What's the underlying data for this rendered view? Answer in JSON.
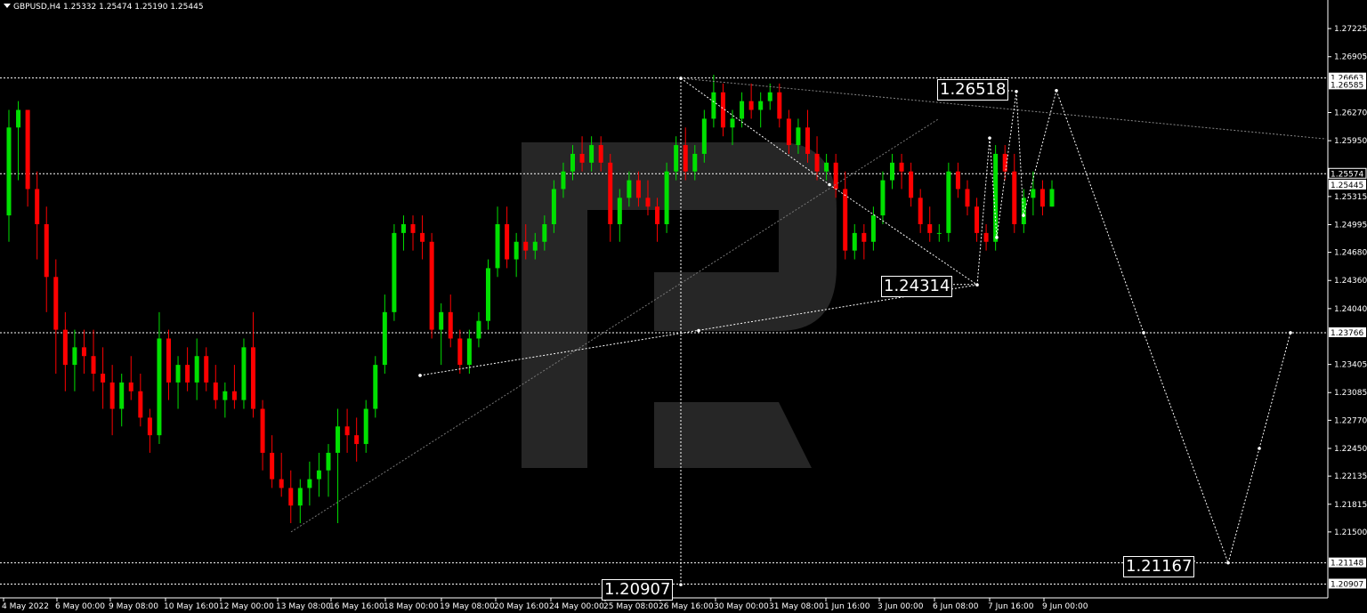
{
  "header": {
    "symbol": "GBPUSD,H4",
    "open": "1.25332",
    "high": "1.25474",
    "low": "1.25190",
    "close": "1.25445"
  },
  "colors": {
    "background": "#000000",
    "bull": "#00e000",
    "bear": "#ff0000",
    "text": "#ffffff",
    "logo": "#2a2a2a"
  },
  "chart_data": {
    "type": "candlestick",
    "symbol": "GBPUSD",
    "timeframe": "H4",
    "ylim": [
      1.2075,
      1.2755
    ],
    "y_ticks": [
      "1.27225",
      "1.26905",
      "1.26270",
      "1.25950",
      "1.25315",
      "1.24995",
      "1.24680",
      "1.24360",
      "1.24040",
      "1.23405",
      "1.23085",
      "1.22770",
      "1.22450",
      "1.22135",
      "1.21815",
      "1.21500"
    ],
    "x_ticks": [
      "4 May 2022",
      "6 May 00:00",
      "9 May 08:00",
      "10 May 16:00",
      "12 May 00:00",
      "13 May 08:00",
      "16 May 16:00",
      "18 May 00:00",
      "19 May 08:00",
      "20 May 16:00",
      "24 May 00:00",
      "25 May 08:00",
      "26 May 16:00",
      "30 May 00:00",
      "31 May 08:00",
      "1 Jun 16:00",
      "3 Jun 00:00",
      "6 Jun 08:00",
      "7 Jun 16:00",
      "9 Jun 00:00"
    ],
    "price_tags": [
      {
        "text": "1.26663",
        "value": 1.26663,
        "style": "white"
      },
      {
        "text": "1.26585",
        "value": 1.26585,
        "style": "white"
      },
      {
        "text": "1.25574",
        "value": 1.25574,
        "style": "black"
      },
      {
        "text": "1.25445",
        "value": 1.25445,
        "style": "white"
      },
      {
        "text": "1.23766",
        "value": 1.23766,
        "style": "white"
      },
      {
        "text": "1.21148",
        "value": 1.21148,
        "style": "white"
      },
      {
        "text": "1.20907",
        "value": 1.20907,
        "style": "white"
      }
    ],
    "horizontal_levels": [
      1.26663,
      1.25574,
      1.23766,
      1.21148,
      1.20907
    ],
    "annotations": [
      {
        "text": "1.26518",
        "anchor": "upper"
      },
      {
        "text": "1.24314",
        "anchor": "middle"
      },
      {
        "text": "1.21167",
        "anchor": "right-bottom"
      },
      {
        "text": "1.20907",
        "anchor": "bottom"
      }
    ],
    "candles_ohlc": [
      [
        1.251,
        1.263,
        1.248,
        1.261
      ],
      [
        1.261,
        1.264,
        1.255,
        1.263
      ],
      [
        1.263,
        1.262,
        1.252,
        1.254
      ],
      [
        1.254,
        1.256,
        1.246,
        1.25
      ],
      [
        1.25,
        1.252,
        1.24,
        1.244
      ],
      [
        1.244,
        1.246,
        1.233,
        1.238
      ],
      [
        1.238,
        1.24,
        1.231,
        1.234
      ],
      [
        1.234,
        1.238,
        1.231,
        1.236
      ],
      [
        1.236,
        1.238,
        1.233,
        1.235
      ],
      [
        1.235,
        1.238,
        1.231,
        1.233
      ],
      [
        1.233,
        1.236,
        1.229,
        1.232
      ],
      [
        1.232,
        1.234,
        1.226,
        1.229
      ],
      [
        1.229,
        1.233,
        1.227,
        1.232
      ],
      [
        1.232,
        1.235,
        1.23,
        1.231
      ],
      [
        1.231,
        1.233,
        1.227,
        1.228
      ],
      [
        1.228,
        1.229,
        1.224,
        1.226
      ],
      [
        1.226,
        1.24,
        1.225,
        1.237
      ],
      [
        1.237,
        1.238,
        1.23,
        1.232
      ],
      [
        1.232,
        1.235,
        1.229,
        1.234
      ],
      [
        1.234,
        1.236,
        1.231,
        1.232
      ],
      [
        1.232,
        1.237,
        1.23,
        1.235
      ],
      [
        1.235,
        1.236,
        1.231,
        1.232
      ],
      [
        1.232,
        1.234,
        1.229,
        1.23
      ],
      [
        1.23,
        1.232,
        1.228,
        1.231
      ],
      [
        1.231,
        1.234,
        1.229,
        1.23
      ],
      [
        1.23,
        1.237,
        1.229,
        1.236
      ],
      [
        1.236,
        1.24,
        1.228,
        1.229
      ],
      [
        1.229,
        1.23,
        1.222,
        1.224
      ],
      [
        1.224,
        1.226,
        1.22,
        1.221
      ],
      [
        1.221,
        1.224,
        1.219,
        1.22
      ],
      [
        1.22,
        1.222,
        1.216,
        1.218
      ],
      [
        1.218,
        1.221,
        1.216,
        1.22
      ],
      [
        1.22,
        1.223,
        1.218,
        1.221
      ],
      [
        1.221,
        1.224,
        1.219,
        1.222
      ],
      [
        1.222,
        1.225,
        1.219,
        1.224
      ],
      [
        1.224,
        1.229,
        1.216,
        1.227
      ],
      [
        1.227,
        1.229,
        1.224,
        1.226
      ],
      [
        1.226,
        1.228,
        1.223,
        1.225
      ],
      [
        1.225,
        1.23,
        1.224,
        1.229
      ],
      [
        1.229,
        1.235,
        1.228,
        1.234
      ],
      [
        1.234,
        1.242,
        1.233,
        1.24
      ],
      [
        1.24,
        1.25,
        1.239,
        1.249
      ],
      [
        1.249,
        1.251,
        1.247,
        1.25
      ],
      [
        1.25,
        1.251,
        1.247,
        1.249
      ],
      [
        1.249,
        1.251,
        1.246,
        1.248
      ],
      [
        1.248,
        1.249,
        1.237,
        1.238
      ],
      [
        1.238,
        1.241,
        1.234,
        1.24
      ],
      [
        1.24,
        1.242,
        1.236,
        1.237
      ],
      [
        1.237,
        1.238,
        1.233,
        1.234
      ],
      [
        1.234,
        1.238,
        1.233,
        1.237
      ],
      [
        1.237,
        1.24,
        1.236,
        1.239
      ],
      [
        1.239,
        1.246,
        1.238,
        1.245
      ],
      [
        1.245,
        1.252,
        1.244,
        1.25
      ],
      [
        1.25,
        1.252,
        1.245,
        1.246
      ],
      [
        1.246,
        1.249,
        1.244,
        1.248
      ],
      [
        1.248,
        1.25,
        1.246,
        1.247
      ],
      [
        1.247,
        1.249,
        1.246,
        1.248
      ],
      [
        1.248,
        1.251,
        1.247,
        1.25
      ],
      [
        1.25,
        1.255,
        1.249,
        1.254
      ],
      [
        1.254,
        1.257,
        1.253,
        1.256
      ],
      [
        1.256,
        1.259,
        1.255,
        1.258
      ],
      [
        1.258,
        1.26,
        1.256,
        1.257
      ],
      [
        1.257,
        1.26,
        1.256,
        1.259
      ],
      [
        1.259,
        1.26,
        1.256,
        1.257
      ],
      [
        1.257,
        1.258,
        1.248,
        1.25
      ],
      [
        1.25,
        1.254,
        1.248,
        1.253
      ],
      [
        1.253,
        1.256,
        1.252,
        1.255
      ],
      [
        1.255,
        1.256,
        1.252,
        1.253
      ],
      [
        1.253,
        1.255,
        1.251,
        1.252
      ],
      [
        1.252,
        1.253,
        1.248,
        1.25
      ],
      [
        1.25,
        1.257,
        1.249,
        1.256
      ],
      [
        1.256,
        1.26,
        1.255,
        1.259
      ],
      [
        1.259,
        1.261,
        1.255,
        1.256
      ],
      [
        1.256,
        1.259,
        1.255,
        1.258
      ],
      [
        1.258,
        1.263,
        1.257,
        1.262
      ],
      [
        1.262,
        1.267,
        1.261,
        1.265
      ],
      [
        1.265,
        1.266,
        1.26,
        1.261
      ],
      [
        1.261,
        1.263,
        1.259,
        1.262
      ],
      [
        1.262,
        1.265,
        1.261,
        1.264
      ],
      [
        1.264,
        1.266,
        1.262,
        1.263
      ],
      [
        1.263,
        1.265,
        1.261,
        1.264
      ],
      [
        1.264,
        1.266,
        1.263,
        1.265
      ],
      [
        1.265,
        1.266,
        1.261,
        1.262
      ],
      [
        1.262,
        1.263,
        1.258,
        1.259
      ],
      [
        1.259,
        1.262,
        1.258,
        1.261
      ],
      [
        1.261,
        1.263,
        1.257,
        1.258
      ],
      [
        1.258,
        1.26,
        1.255,
        1.256
      ],
      [
        1.256,
        1.258,
        1.255,
        1.257
      ],
      [
        1.257,
        1.258,
        1.253,
        1.254
      ],
      [
        1.254,
        1.256,
        1.246,
        1.247
      ],
      [
        1.247,
        1.25,
        1.246,
        1.249
      ],
      [
        1.249,
        1.25,
        1.246,
        1.248
      ],
      [
        1.248,
        1.252,
        1.247,
        1.251
      ],
      [
        1.251,
        1.256,
        1.25,
        1.255
      ],
      [
        1.255,
        1.258,
        1.254,
        1.257
      ],
      [
        1.257,
        1.258,
        1.254,
        1.256
      ],
      [
        1.256,
        1.257,
        1.252,
        1.253
      ],
      [
        1.253,
        1.254,
        1.249,
        1.25
      ],
      [
        1.25,
        1.252,
        1.248,
        1.249
      ],
      [
        1.249,
        1.25,
        1.248,
        1.249
      ],
      [
        1.249,
        1.257,
        1.248,
        1.256
      ],
      [
        1.256,
        1.257,
        1.253,
        1.254
      ],
      [
        1.254,
        1.255,
        1.251,
        1.252
      ],
      [
        1.252,
        1.253,
        1.248,
        1.249
      ],
      [
        1.249,
        1.25,
        1.247,
        1.248
      ],
      [
        1.248,
        1.259,
        1.247,
        1.258
      ],
      [
        1.258,
        1.259,
        1.255,
        1.256
      ],
      [
        1.256,
        1.258,
        1.249,
        1.25
      ],
      [
        1.25,
        1.254,
        1.249,
        1.253
      ],
      [
        1.253,
        1.256,
        1.251,
        1.254
      ],
      [
        1.254,
        1.255,
        1.251,
        1.252
      ],
      [
        1.252,
        1.255,
        1.252,
        1.254
      ]
    ],
    "forecast_path_values": [
      1.25445,
      1.26518,
      1.23766,
      1.21167,
      1.23766
    ]
  }
}
